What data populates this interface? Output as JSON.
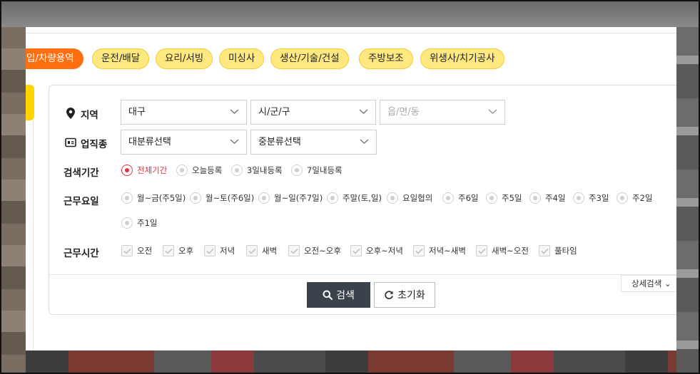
{
  "categories": [
    {
      "label": "입/차량용역",
      "active": true
    },
    {
      "label": "운전/배달",
      "active": false
    },
    {
      "label": "요리/서빙",
      "active": false
    },
    {
      "label": "미싱사",
      "active": false
    },
    {
      "label": "생산/기술/건설",
      "active": false
    },
    {
      "label": "주방보조",
      "active": false
    },
    {
      "label": "위생사/치기공사",
      "active": false
    }
  ],
  "filters": {
    "region": {
      "label": "지역",
      "icon": "location-pin-icon",
      "selects": [
        {
          "value": "대구"
        },
        {
          "value": "시/군/구"
        },
        {
          "value": "읍/면/동",
          "disabled": true
        }
      ]
    },
    "job_type": {
      "label": "업직종",
      "icon": "business-card-icon",
      "selects": [
        {
          "value": "대분류선택"
        },
        {
          "value": "중분류선택"
        }
      ]
    },
    "period": {
      "label": "검색기간",
      "options": [
        "전체기간",
        "오늘등록",
        "3일내등록",
        "7일내등록"
      ],
      "selected": "전체기간"
    },
    "workdays": {
      "label": "근무요일",
      "options": [
        "월~금(주5일)",
        "월~토(주6일)",
        "월~일(주7일)",
        "주말(토,일)",
        "요일협의",
        "주6일",
        "주5일",
        "주4일",
        "주3일",
        "주2일",
        "주1일"
      ]
    },
    "worktime": {
      "label": "근무시간",
      "options": [
        "오전",
        "오후",
        "저녁",
        "새벽",
        "오전~오후",
        "오후~저녁",
        "저녁~새벽",
        "새벽~오전",
        "풀타임"
      ]
    }
  },
  "actions": {
    "search_label": "검색",
    "reset_label": "초기화",
    "detail_label": "상세검색 ⌄"
  },
  "colors": {
    "accent_orange": "#ff6f12",
    "chip_yellow": "#ffe880",
    "selected_red": "#e8323f",
    "search_button": "#3a424c"
  }
}
